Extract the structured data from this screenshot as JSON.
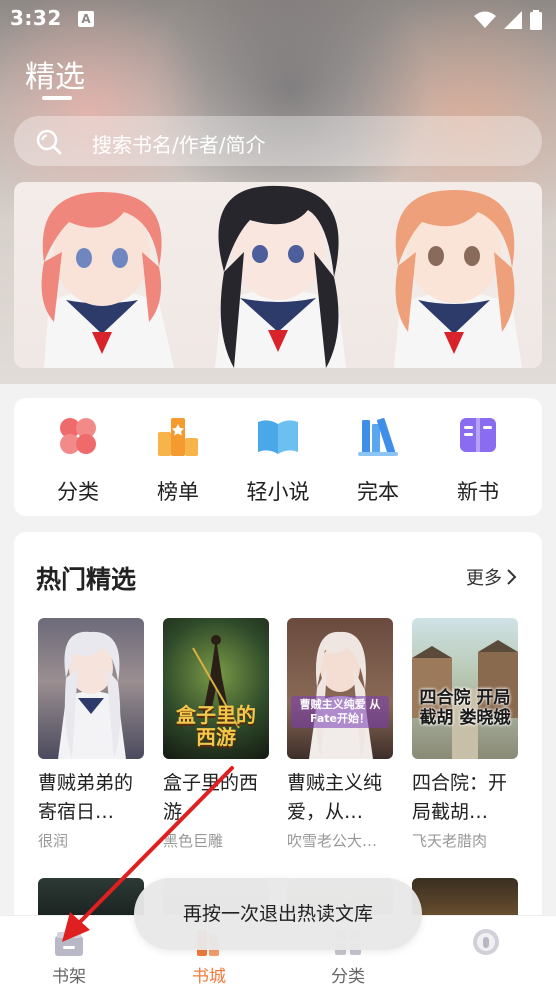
{
  "status_bar": {
    "time": "3:32",
    "notification_badge": "A"
  },
  "header": {
    "title": "精选"
  },
  "search": {
    "placeholder": "搜索书名/作者/简介"
  },
  "categories": [
    {
      "label": "分类",
      "icon": "clover-icon",
      "color": "#ef6a6a"
    },
    {
      "label": "榜单",
      "icon": "ranking-icon",
      "color": "#f7a23a"
    },
    {
      "label": "轻小说",
      "icon": "open-book-icon",
      "color": "#4aa8e8"
    },
    {
      "label": "完本",
      "icon": "books-stack-icon",
      "color": "#3f8fe8"
    },
    {
      "label": "新书",
      "icon": "new-book-icon",
      "color": "#8a6cf0"
    }
  ],
  "hot_picks": {
    "title": "热门精选",
    "more_label": "更多",
    "books": [
      {
        "title": "曹贼弟弟的寄宿日…",
        "author": "很润"
      },
      {
        "title": "盒子里的西游",
        "author": "黑色巨雕",
        "cover_text": "盒子里的西游"
      },
      {
        "title": "曹贼主义纯爱，从…",
        "author": "吹雪老公大…",
        "cover_text": "曹贼主义纯爱 从Fate开始！"
      },
      {
        "title": "四合院：开局截胡…",
        "author": "飞天老腊肉",
        "cover_text": "四合院 开局截胡 娄晓娥"
      }
    ]
  },
  "toast": {
    "message": "再按一次退出热读文库"
  },
  "bottom_nav": [
    {
      "label": "书架",
      "icon": "bookshelf-icon"
    },
    {
      "label": "书城",
      "icon": "bookstore-icon",
      "active": true
    },
    {
      "label": "分类",
      "icon": "category-icon"
    },
    {
      "label": "",
      "icon": "profile-icon"
    }
  ],
  "colors": {
    "accent": "#f07b3c",
    "arrow": "#e02020"
  }
}
